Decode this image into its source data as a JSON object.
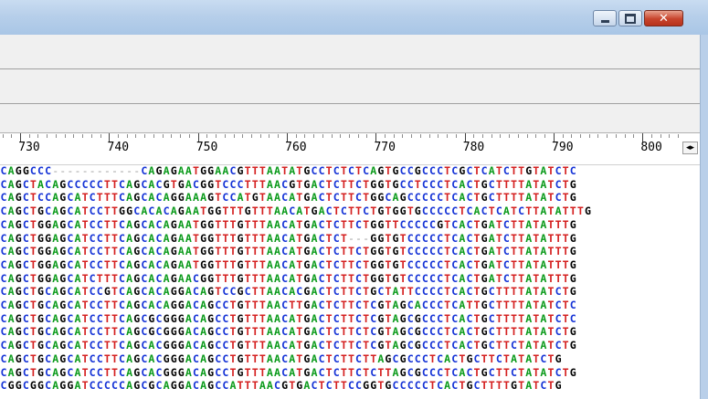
{
  "window": {
    "controls": {
      "minimize": "minimize",
      "maximize": "maximize",
      "close": "close"
    }
  },
  "ruler": {
    "labels": [
      "730",
      "740",
      "750",
      "760",
      "770",
      "780",
      "790",
      "800"
    ]
  },
  "scroll_glyph": "◂▸",
  "colors": {
    "A": "#0a9a1a",
    "C": "#1533d6",
    "G": "#000000",
    "T": "#d42020",
    "gap": "#a0a0a0"
  },
  "alignment": [
    "CAGGCCC------------CAGAGAATGGAACGTTTAATATGCCTCTCTCAGTGCCGCCCTCGCTCATCTTGTATCTC",
    "CAGCTACAGCCCCCTTCAGCACGTGACGGTCCCTTTAACGTGACTCTTCTGGTGCCTCCCTCACTGCTTTTATATCTG",
    "CAGCTCCAGCATCTTTCAGCACAGGAAAGTCCATGTAACATGACTCTTCTGGCAGCCCCCTCACTGCTTTTATATCTG",
    "CAGCTGCAGCATCCTTGGCACACAGAATGGTTTGTTTAACATGACTCTTCTGTGGTGCCCCCTCACTCATCTTATATTTG",
    "CAGCTGGAGCATCCTTCAGCACAGAATGGTTTGTTTAACATGACTCTTCTGGTTCCCCCGTCACTGATCTTATATTTG",
    "CAGCTGGAGCATCCTTCAGCACAGAATGGTTTGTTTAACATGACTCT---GGTGTCCCCCTCACTGATCTTATATTTG",
    "CAGCTGGAGCATCCTTCAGCACAGAATGGTTTGTTTAACATGACTCTTCTGGTGTCCCCCTCACTGATCTTATATTTG",
    "CAGCTGGAGCATCCTTCAGCACAGAATGGTTTGTTTAACATGACTCTTCTGGTGTCCCCCTCACTGATCTTATATTTG",
    "CAGCTGGAGCATCTTTCAGCACAGAACGGTTTGTTTAACATGACTCTTCTGGTGTCCCCCTCACTGATCTTATATTTG",
    "CAGCTGCAGCATCCGTCAGCACAGGACAGTCCGCTTAACACGACTCTTCTGCTATTCCCCTCACTGCTTTTATATCTG",
    "CAGCTGCAGCATCCTTCAGCACAGGACAGCCTGTTTAACTTGACTCTTCTCGTAGCACCCTCATTGCTTTTATATCTC",
    "CAGCTGCAGCATCCTTCAGCGCGGGACAGCCTGTTTAACATGACTCTTCTCGTAGCGCCCTCACTGCTTTTATATCTC",
    "CAGCTGCAGCATCCTTCAGCGCGGGACAGCCTGTTTAACATGACTCTTCTCGTAGCGCCCTCACTGCTTTTATATCTG",
    "CAGCTGCAGCATCCTTCAGCACGGGACAGCCTGTTTAACATGACTCTTCTCGTAGCGCCCTCACTGCTTCTATATCTG",
    "CAGCTGCAGCATCCTTCAGCACGGGACAGCCTGTTTAACATGACTCTTCTTAGCGCCCTCACTGCTTCTATATCTG",
    "CAGCTGCAGCATCCTTCAGCACGGGACAGCCTGTTTAACATGACTCTTCTCTTAGCGCCCTCACTGCTTCTATATCTG",
    "CGGCGGCAGGATCCCCCAGCGCAGGACAGCCATTTAACGTGACTCTTCCGGTGCCCCCTCACTGCTTTTGTATCTG"
  ]
}
